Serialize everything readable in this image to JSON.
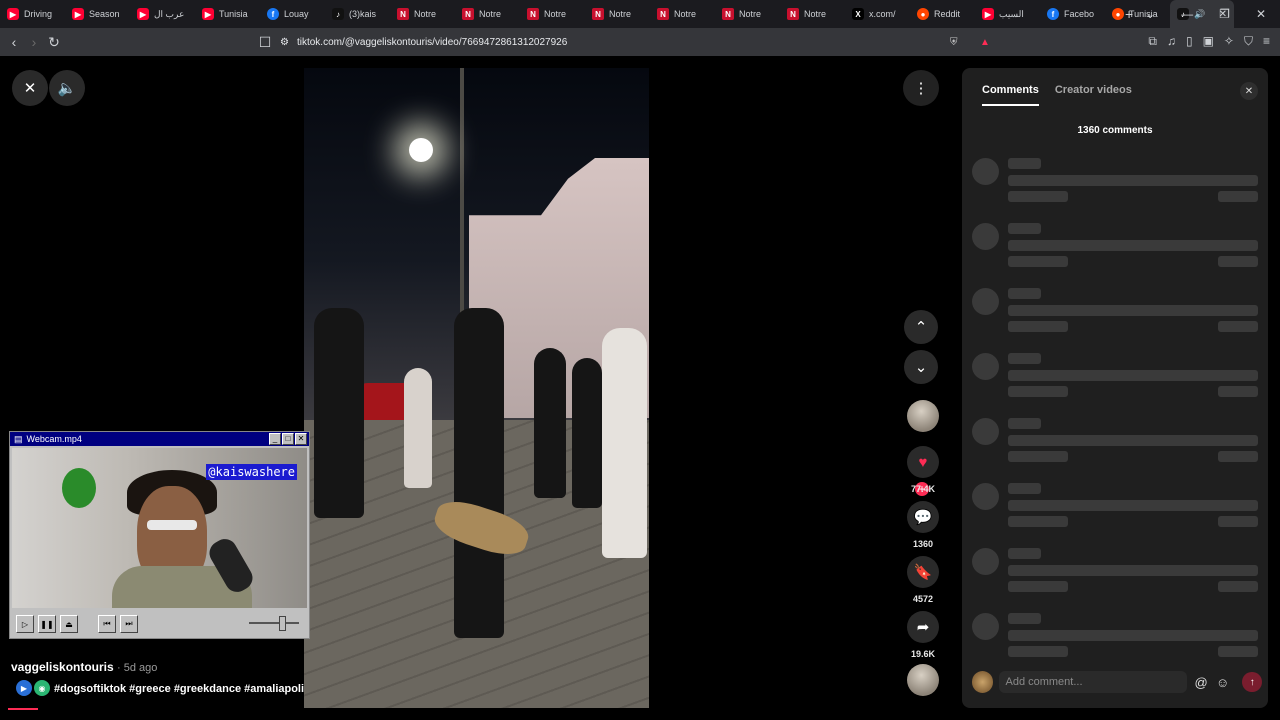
{
  "tabs": [
    {
      "label": "Driving",
      "favicon": "youtube"
    },
    {
      "label": "Season",
      "favicon": "youtube"
    },
    {
      "label": "عرب ال",
      "favicon": "youtube"
    },
    {
      "label": "Tunisia",
      "favicon": "youtube"
    },
    {
      "label": "Louay",
      "favicon": "facebook"
    },
    {
      "label": "(3)kais",
      "favicon": "tiktok"
    },
    {
      "label": "Notre",
      "favicon": "notre-dame"
    },
    {
      "label": "Notre",
      "favicon": "notre-dame"
    },
    {
      "label": "Notre",
      "favicon": "notre-dame"
    },
    {
      "label": "Notre",
      "favicon": "notre-dame"
    },
    {
      "label": "Notre",
      "favicon": "notre-dame"
    },
    {
      "label": "Notre",
      "favicon": "notre-dame"
    },
    {
      "label": "Notre",
      "favicon": "notre-dame"
    },
    {
      "label": "x.com/",
      "favicon": "x"
    },
    {
      "label": "Reddit",
      "favicon": "reddit"
    },
    {
      "label": "السيب",
      "favicon": "youtube"
    },
    {
      "label": "Facebo",
      "favicon": "facebook"
    },
    {
      "label": "Tunisia",
      "favicon": "reddit"
    }
  ],
  "address": {
    "url": "tiktok.com/@vaggeliskontouris/video/7669472861312027926"
  },
  "video": {
    "author": "vaggeliskontouris",
    "age": "· 5d ago",
    "hashtags": "#dogsoftiktok #greece #greekdance #amaliapoli"
  },
  "actions": {
    "likes": "77.4K",
    "comments": "1360",
    "saves": "4572",
    "shares": "19.6K"
  },
  "webcam": {
    "title": "Webcam.mp4",
    "handle": "@kaiswashere"
  },
  "panel": {
    "tab_comments": "Comments",
    "tab_creator": "Creator videos",
    "count_label": "1360 comments",
    "input_placeholder": "Add comment...",
    "skeleton_rows": 8
  },
  "colors": {
    "accent": "#fe2c55",
    "bookmark": "#facc15",
    "panel_bg": "#1f1f1f"
  }
}
